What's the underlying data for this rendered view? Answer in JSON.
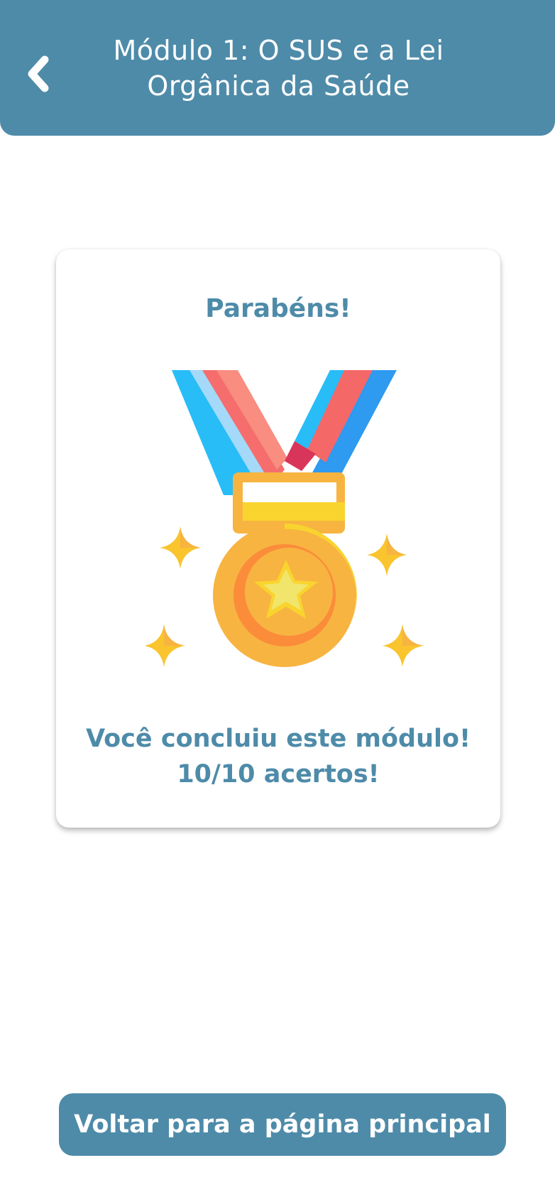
{
  "header": {
    "title_line1": "Módulo 1: O SUS e a Lei",
    "title_line2": "Orgânica da Saúde",
    "back_icon": "chevron-left-icon"
  },
  "card": {
    "heading": "Parabéns!",
    "illustration": "medal-icon",
    "message_line1": "Você concluiu este módulo!",
    "message_line2": "10/10 acertos!"
  },
  "footer": {
    "button_label": "Voltar para a página principal"
  },
  "colors": {
    "primary": "#4e8ba9",
    "background": "#ffffff"
  }
}
